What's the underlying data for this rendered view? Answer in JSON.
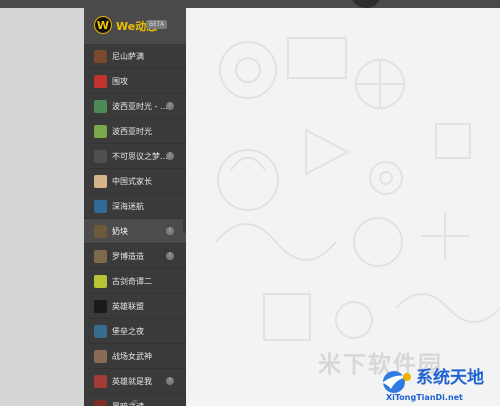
{
  "brand": {
    "logo_letter": "W",
    "title": "We动态",
    "badge": "BETA"
  },
  "colors": {
    "sidebar_bg": "#3a3a3a",
    "brand_bg": "#4a4a4a",
    "brand_text": "#f0c000",
    "content_bg": "#f3f3f3",
    "watermark_blue": "#1e62d4"
  },
  "sidebar": {
    "items": [
      {
        "label": "尼山萨满",
        "icon": "nishan-shaman-icon",
        "color": "#7a4a2a",
        "has_badge": false,
        "badge_text": "",
        "active": false
      },
      {
        "label": "围攻",
        "icon": "besiege-icon",
        "color": "#c0332f",
        "has_badge": false,
        "badge_text": "",
        "active": false
      },
      {
        "label": "波西亚时光 - ...",
        "icon": "portia-icon",
        "color": "#4e8a57",
        "has_badge": true,
        "badge_text": "!",
        "active": false
      },
      {
        "label": "波西亚时光",
        "icon": "portia-icon-2",
        "color": "#79a94a",
        "has_badge": false,
        "badge_text": "",
        "active": false
      },
      {
        "label": "不可思议之梦...",
        "icon": "dream-icon",
        "color": "#4f4f4f",
        "has_badge": true,
        "badge_text": "!",
        "active": false
      },
      {
        "label": "中国式家长",
        "icon": "chinese-parents-icon",
        "color": "#d7b58b",
        "has_badge": false,
        "badge_text": "",
        "active": false
      },
      {
        "label": "深海迷航",
        "icon": "subnautica-icon",
        "color": "#2f6b98",
        "has_badge": false,
        "badge_text": "",
        "active": false
      },
      {
        "label": "奶块",
        "icon": "milk-block-icon",
        "color": "#6b5a3a",
        "has_badge": true,
        "badge_text": "!",
        "active": true
      },
      {
        "label": "罗博造造",
        "icon": "robocraft-icon",
        "color": "#7c6a4b",
        "has_badge": true,
        "badge_text": "!",
        "active": false
      },
      {
        "label": "古剑奇谭二",
        "icon": "gujian-icon",
        "color": "#b8c436",
        "has_badge": false,
        "badge_text": "",
        "active": false
      },
      {
        "label": "英雄联盟",
        "icon": "lol-icon",
        "color": "#1b1b1b",
        "has_badge": false,
        "badge_text": "",
        "active": false
      },
      {
        "label": "堡垒之夜",
        "icon": "fortnite-icon",
        "color": "#376b8f",
        "has_badge": false,
        "badge_text": "",
        "active": false
      },
      {
        "label": "战场女武神",
        "icon": "valkyria-icon",
        "color": "#8a6b55",
        "has_badge": false,
        "badge_text": "",
        "active": false
      },
      {
        "label": "英雄就是我",
        "icon": "hero-icon",
        "color": "#a23a35",
        "has_badge": true,
        "badge_text": "!",
        "active": false
      },
      {
        "label": "黑暗之魂",
        "icon": "dark-icon",
        "color": "#7b2d27",
        "has_badge": false,
        "badge_text": "",
        "active": false
      }
    ],
    "scroll_glyph": "≡",
    "collapse_glyph": "‹"
  },
  "watermark": {
    "faded_text": "米下软件园",
    "logo_title": "系统天地",
    "logo_url": "XiTongTianDi.net"
  }
}
